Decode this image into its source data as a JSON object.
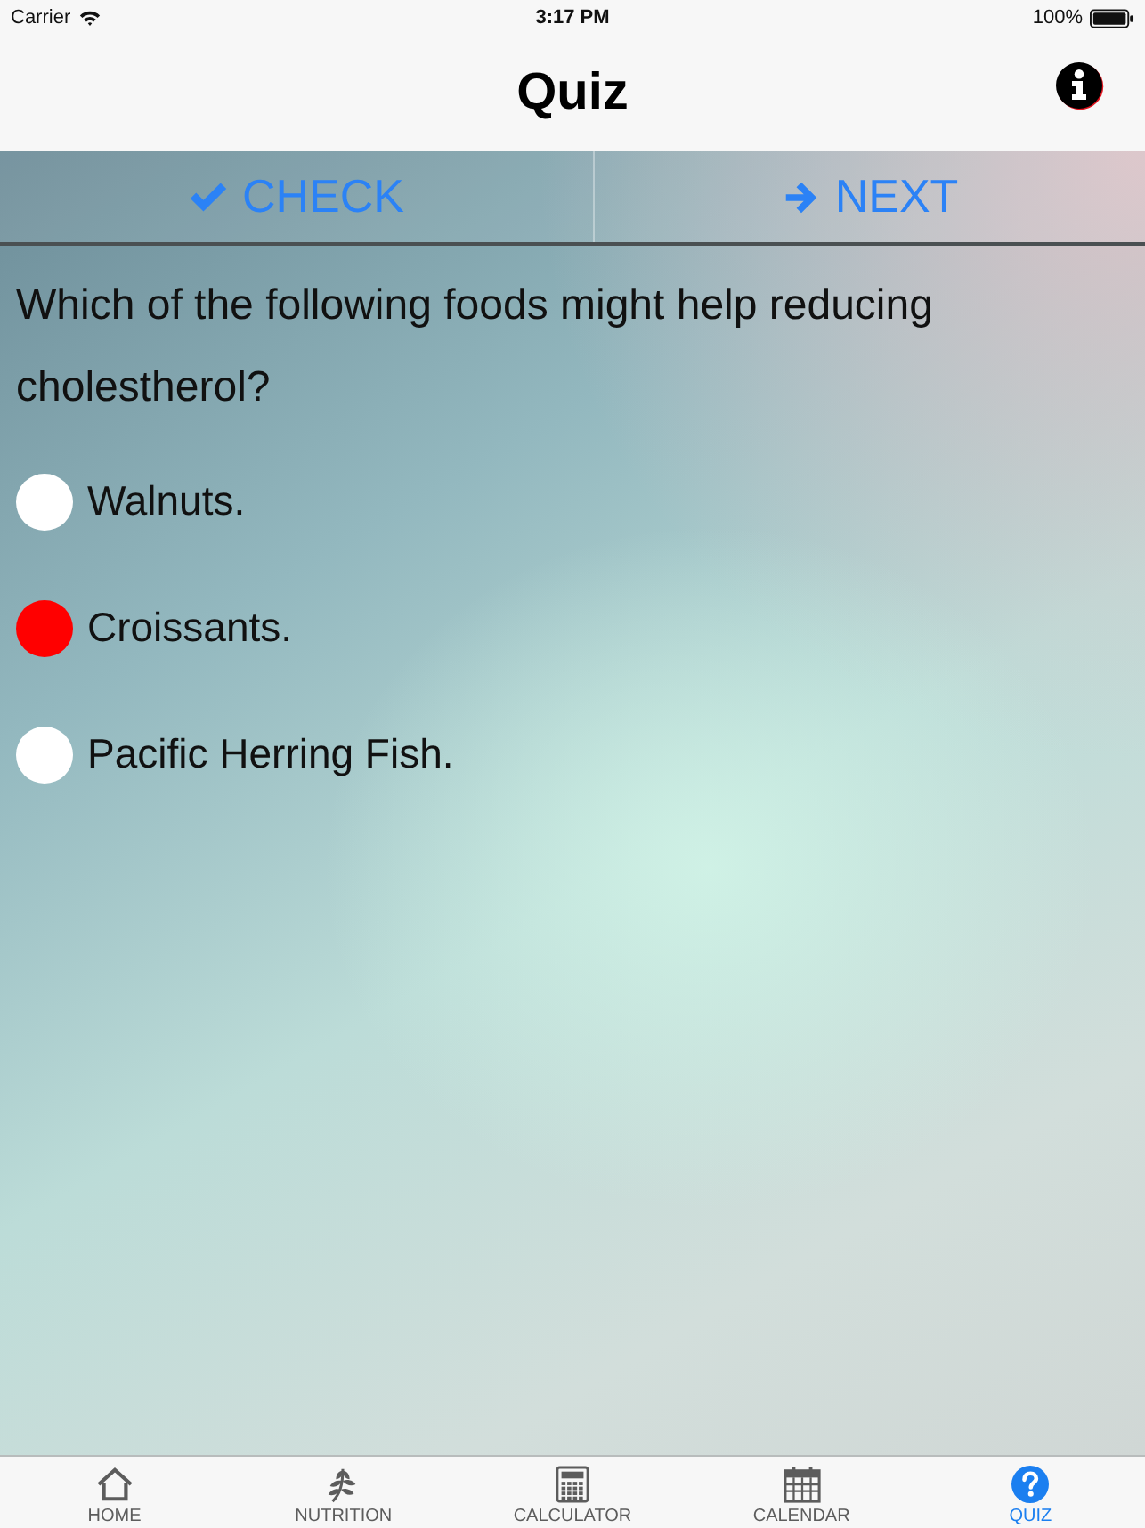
{
  "status_bar": {
    "carrier": "Carrier",
    "time": "3:17 PM",
    "battery": "100%"
  },
  "nav_bar": {
    "title": "Quiz"
  },
  "toolbar": [
    {
      "label": "CHECK",
      "kind": "check"
    },
    {
      "label": "NEXT",
      "kind": "next"
    }
  ],
  "question": "Which of the following foods might help reducing cholestherol?",
  "options": [
    {
      "label": "Walnuts.",
      "selected": false
    },
    {
      "label": "Croissants.",
      "selected": true
    },
    {
      "label": "Pacific Herring Fish.",
      "selected": false
    }
  ],
  "tab_bar": [
    {
      "label": "HOME",
      "kind": "home",
      "selected": false
    },
    {
      "label": "NUTRITION",
      "kind": "nutrition",
      "selected": false
    },
    {
      "label": "CALCULATOR",
      "kind": "calculator",
      "selected": false
    },
    {
      "label": "CALENDAR",
      "kind": "calendar",
      "selected": false
    },
    {
      "label": "QUIZ",
      "kind": "quiz",
      "selected": true
    }
  ]
}
